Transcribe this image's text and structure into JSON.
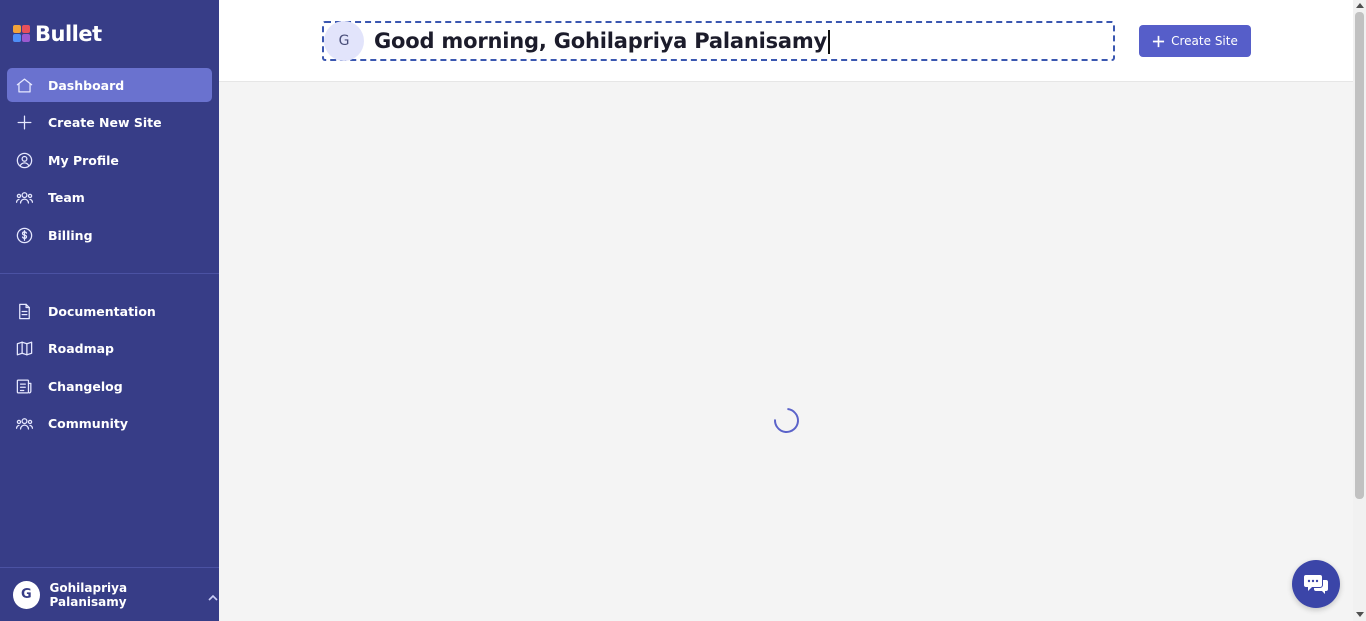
{
  "brand": {
    "name": "Bullet",
    "sidebar_color": "#373d87",
    "accent": "#565ec9"
  },
  "sidebar": {
    "primary_items": [
      {
        "label": "Dashboard",
        "icon": "home-icon",
        "active": true
      },
      {
        "label": "Create New Site",
        "icon": "plus-icon"
      },
      {
        "label": "My Profile",
        "icon": "user-circle-icon"
      },
      {
        "label": "Team",
        "icon": "team-icon"
      },
      {
        "label": "Billing",
        "icon": "dollar-icon"
      }
    ],
    "secondary_items": [
      {
        "label": "Documentation",
        "icon": "document-icon"
      },
      {
        "label": "Roadmap",
        "icon": "map-icon"
      },
      {
        "label": "Changelog",
        "icon": "changelog-icon"
      },
      {
        "label": "Community",
        "icon": "community-icon"
      }
    ],
    "user": {
      "initial": "G",
      "name": "Gohilapriya Palanisamy"
    }
  },
  "header": {
    "avatar_initial": "G",
    "greeting": "Good morning, Gohilapriya Palanisamy",
    "create_button_label": "Create Site"
  }
}
